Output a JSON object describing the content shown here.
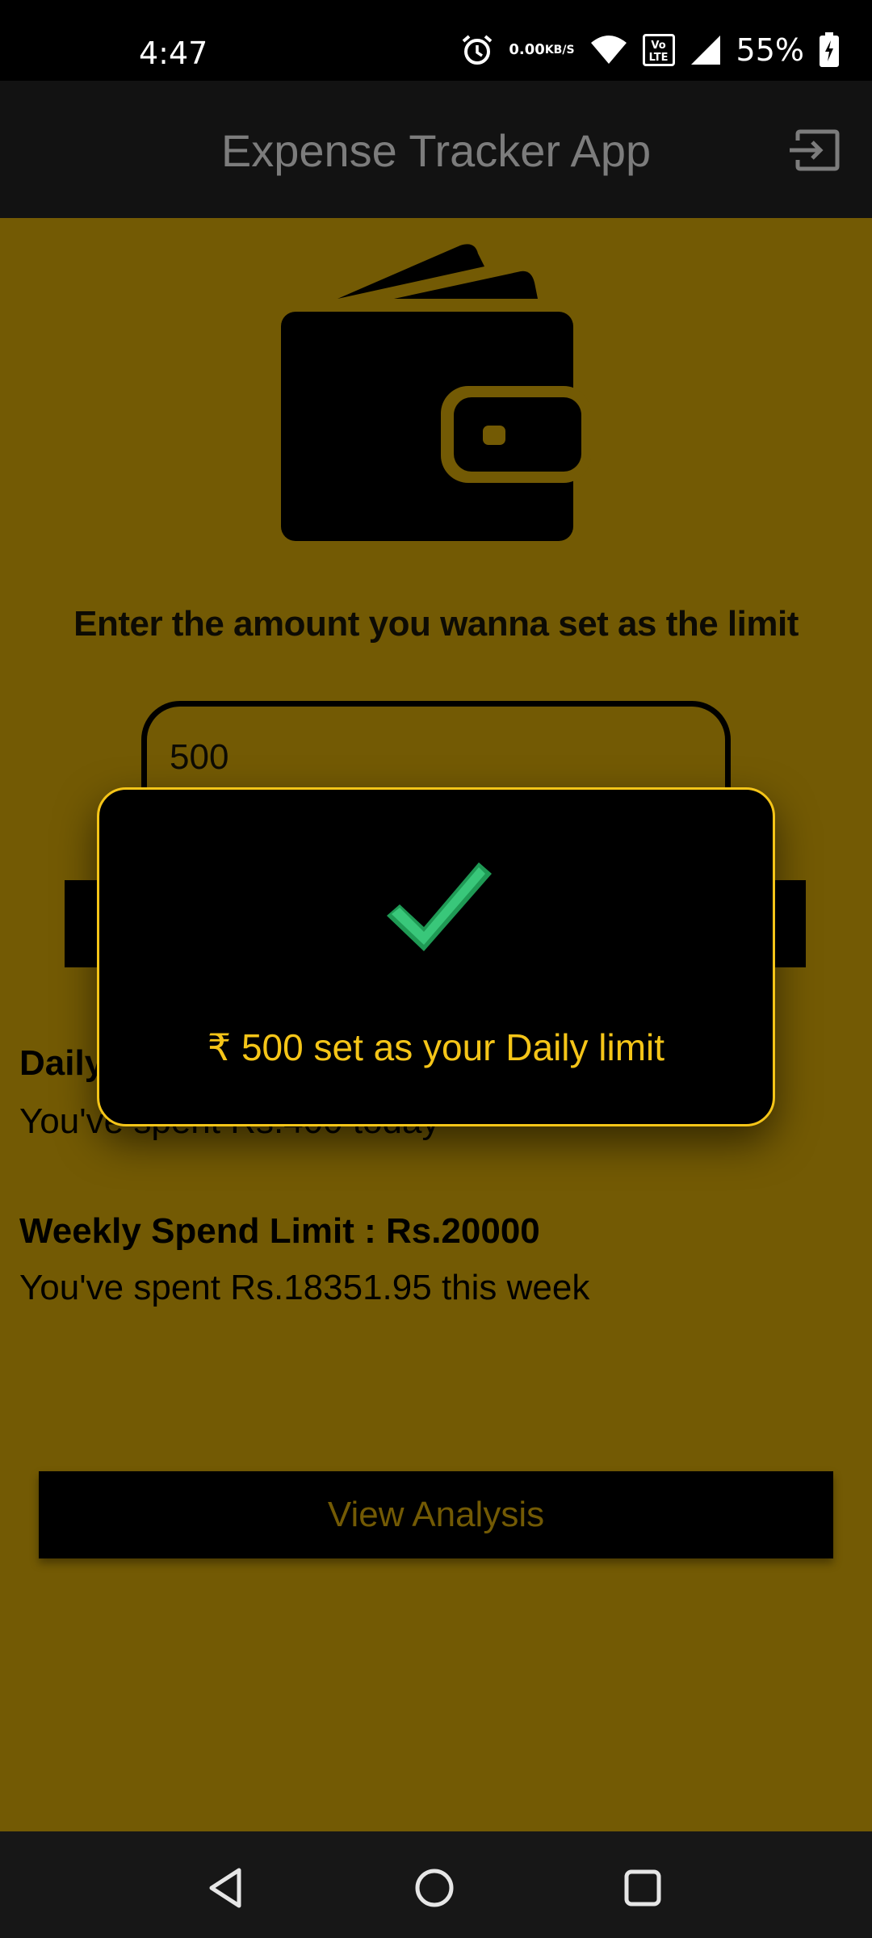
{
  "status_bar": {
    "time": "4:47",
    "net_speed_value": "0.00",
    "net_speed_unit": "KB/S",
    "volte_label": "Vo LTE",
    "battery_percent": "55%",
    "icons": [
      "alarm-icon",
      "wifi-icon",
      "volte-icon",
      "signal-icon",
      "battery-charging-icon"
    ]
  },
  "app_bar": {
    "title": "Expense Tracker App",
    "action_icon": "logout-icon"
  },
  "main": {
    "illustration": "wallet-icon",
    "prompt": "Enter the amount you wanna set as the limit",
    "amount_input_value": "500",
    "daily_title": "Daily Spend Limit : Rs.500",
    "daily_spent": "You've spent Rs.400 today",
    "weekly_title": "Weekly Spend Limit : Rs.20000",
    "weekly_spent": "You've spent Rs.18351.95 this week",
    "view_analysis_label": "View Analysis"
  },
  "dialog": {
    "icon": "checkmark-icon",
    "message": "₹ 500 set as your Daily limit"
  },
  "nav_bar": {
    "icons": [
      "back-icon",
      "home-icon",
      "recents-icon"
    ]
  },
  "colors": {
    "background": "#735a04",
    "accent": "#f5c518",
    "app_bar": "#121212",
    "success": "#2fb36a"
  }
}
